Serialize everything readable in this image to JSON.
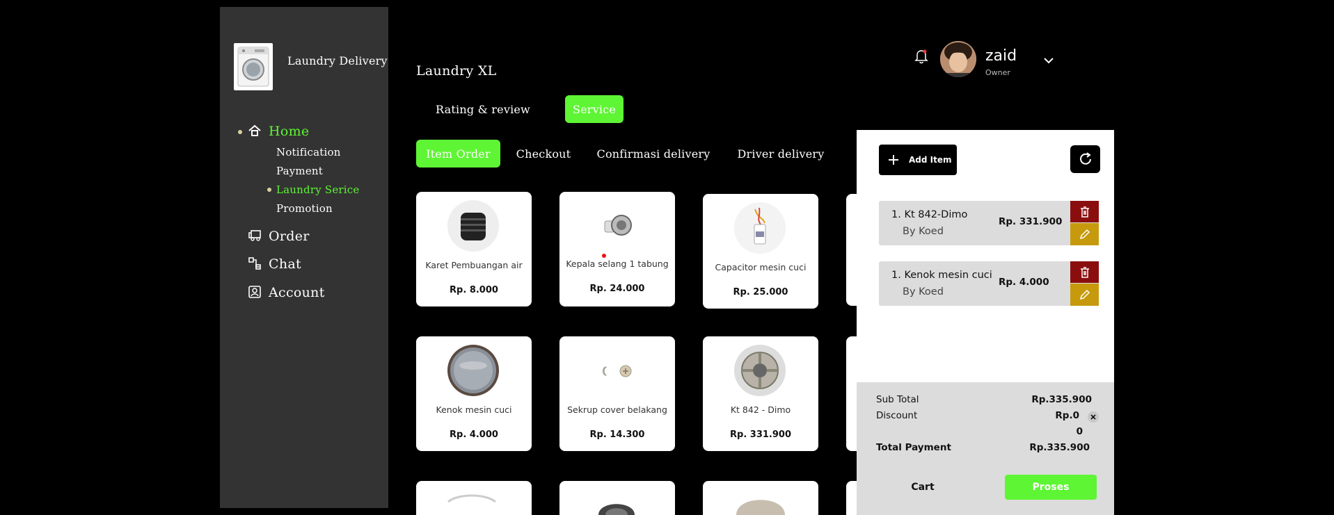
{
  "sidebar": {
    "app_name": "Laundry Delivery",
    "nav": {
      "home": "Home",
      "sub": [
        "Notification",
        "Payment",
        "Laundry Serice",
        "Promotion"
      ],
      "order": "Order",
      "chat": "Chat",
      "account": "Account"
    }
  },
  "header": {
    "shop_name": "Laundry XL",
    "user": {
      "name": "zaid",
      "role": "Owner"
    }
  },
  "top_tabs": [
    "Rating & review",
    "Service"
  ],
  "order_tabs": [
    "Item Order",
    "Checkout",
    "Confirmasi delivery",
    "Driver delivery"
  ],
  "products": [
    {
      "name": "Karet Pembuangan air",
      "price": "Rp. 8.000",
      "icon": "rubber-drain-icon"
    },
    {
      "name": "Kepala selang 1 tabung",
      "price": "Rp. 24.000",
      "icon": "hose-head-icon"
    },
    {
      "name": "Capacitor mesin cuci",
      "price": "Rp. 25.000",
      "icon": "capacitor-icon"
    },
    {
      "name": "Kenok mesin cuci",
      "price": "Rp. 4.000",
      "icon": "knob-icon"
    },
    {
      "name": "Sekrup cover belakang",
      "price": "Rp. 14.300",
      "icon": "screw-icon"
    },
    {
      "name": "Kt 842 - Dimo",
      "price": "Rp. 331.900",
      "icon": "pulley-icon"
    }
  ],
  "cart": {
    "add_item_label": "Add Item",
    "items": [
      {
        "name": "1. Kt 842-Dimo",
        "by": "By Koed",
        "price": "Rp. 331.900"
      },
      {
        "name": "1. Kenok mesin cuci",
        "by": "By Koed",
        "price": "Rp. 4.000"
      }
    ],
    "summary": {
      "subtotal_label": "Sub Total",
      "subtotal": "Rp.335.900",
      "discount_label": "Discount",
      "discount": "Rp.0",
      "discount_extra": "0",
      "total_label": "Total Payment",
      "total": "Rp.335.900"
    },
    "cart_label": "Cart",
    "proses_label": "Proses"
  },
  "colors": {
    "accent": "#5ef534",
    "sidebar": "#333333",
    "delete": "#8b0e0e",
    "edit": "#c79a0e"
  }
}
